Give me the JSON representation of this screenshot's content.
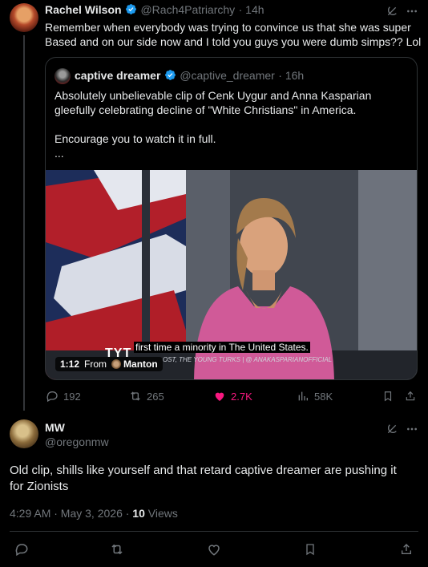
{
  "tweet1": {
    "name": "Rachel Wilson",
    "handle": "@Rach4Patriarchy",
    "time": "· 14h",
    "text_line1": "Remember when everybody was trying to convince us that she was super",
    "text_line2": "Based and on our side now and I told you guys you were dumb simps?? Lol",
    "quote": {
      "name": "captive dreamer",
      "handle": "@captive_dreamer",
      "time": "· 16h",
      "line1": "Absolutely unbelievable clip of Cenk Uygur and Anna Kasparian",
      "line2": "gleefully celebrating decline of \"White Christians\" in America.",
      "line3": "Encourage you to watch it in full.",
      "line4": "...",
      "video": {
        "caption": "first time a minority in The United States.",
        "tvt_logo": "TYT",
        "lower_third": "OST, THE YOUNG TURKS | @ ANAKASPARIANOFFICIAL",
        "duration": "1:12",
        "from_label": "From",
        "from_name": "Manton"
      }
    },
    "actions": {
      "replies": "192",
      "reposts": "265",
      "likes": "2.7K",
      "views": "58K"
    }
  },
  "tweet2": {
    "name": "MW",
    "handle": "@oregonmw",
    "text_line1": "Old clip, shills like yourself and that retard captive dreamer are pushing it",
    "text_line2": "for Zionists",
    "timestamp": "4:29 AM · May 3, 2026 · ",
    "views_count": "10",
    "views_label": " Views"
  },
  "colors": {
    "background": "#000000",
    "text": "#e7e9ea",
    "muted": "#71767b",
    "border": "#2f3336",
    "verified": "#1d9bf0",
    "like_pink": "#f91880"
  },
  "icons": [
    "grok-icon",
    "more-icon",
    "verified-icon",
    "reply-icon",
    "repost-icon",
    "like-icon",
    "views-icon",
    "bookmark-icon",
    "share-icon"
  ]
}
